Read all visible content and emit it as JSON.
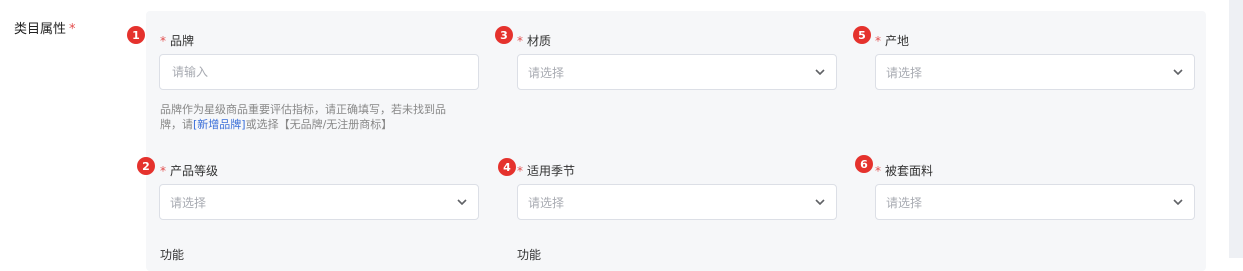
{
  "section": {
    "label": "类目属性",
    "required_mark": "*"
  },
  "fields": {
    "brand": {
      "badge": "1",
      "star": "*",
      "label": "品牌",
      "placeholder": "请输入"
    },
    "material": {
      "badge": "3",
      "star": "*",
      "label": "材质",
      "placeholder": "请选择"
    },
    "origin": {
      "badge": "5",
      "star": "*",
      "label": "产地",
      "placeholder": "请选择"
    },
    "grade": {
      "badge": "2",
      "star": "*",
      "label": "产品等级",
      "placeholder": "请选择"
    },
    "season": {
      "badge": "4",
      "star": "*",
      "label": "适用季节",
      "placeholder": "请选择"
    },
    "fabric": {
      "badge": "6",
      "star": "*",
      "label": "被套面料",
      "placeholder": "请选择"
    }
  },
  "brand_hint": {
    "line1": "品牌作为星级商品重要评估指标，请正确填写，若未找到品",
    "line2_prefix": "牌，请",
    "link": "[新增品牌]",
    "line2_suffix": "或选择【无品牌/无注册商标】"
  },
  "next_row": {
    "label_1": "功能",
    "label_2": "功能"
  },
  "colors": {
    "badge": "#e5322d",
    "required": "#e34d4d",
    "link": "#3b6fd9",
    "panel": "#f6f7f9"
  },
  "icons": {
    "dropdown": "chevron-down-icon"
  }
}
